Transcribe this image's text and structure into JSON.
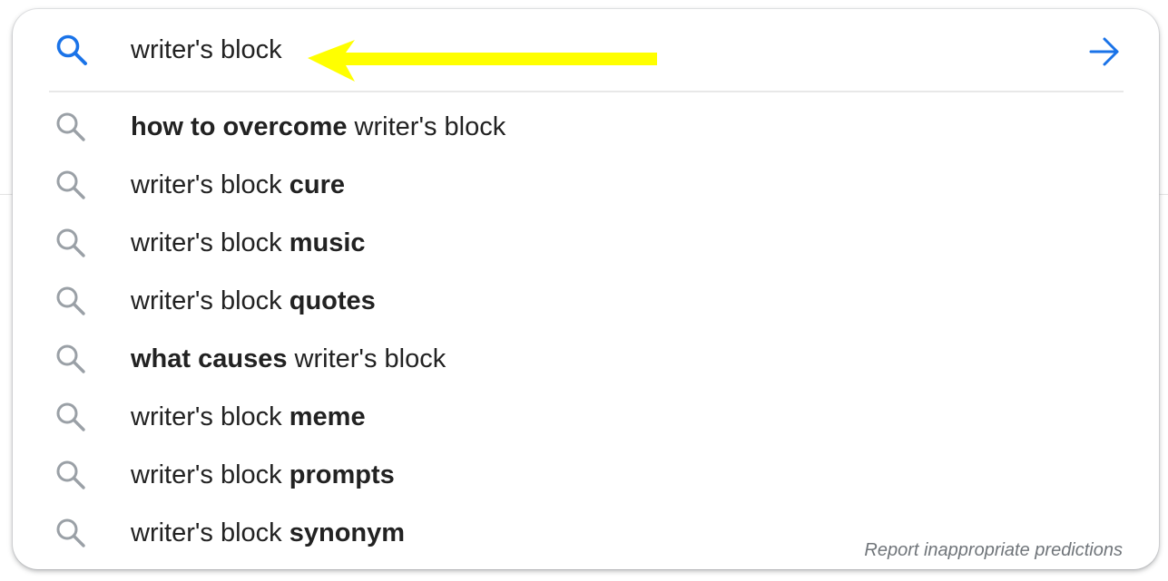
{
  "search": {
    "query": "writer's block",
    "accent_color": "#1a73e8"
  },
  "annotation": {
    "arrow_color": "#ffff00"
  },
  "suggestions": [
    {
      "pre": "",
      "bold_pre": "how to overcome",
      "mid": " writer's block",
      "bold_post": ""
    },
    {
      "pre": "",
      "bold_pre": "",
      "mid": "writer's block ",
      "bold_post": "cure"
    },
    {
      "pre": "",
      "bold_pre": "",
      "mid": "writer's block ",
      "bold_post": "music"
    },
    {
      "pre": "",
      "bold_pre": "",
      "mid": "writer's block ",
      "bold_post": "quotes"
    },
    {
      "pre": "",
      "bold_pre": "what causes",
      "mid": " writer's block",
      "bold_post": ""
    },
    {
      "pre": "",
      "bold_pre": "",
      "mid": "writer's block ",
      "bold_post": "meme"
    },
    {
      "pre": "",
      "bold_pre": "",
      "mid": "writer's block ",
      "bold_post": "prompts"
    },
    {
      "pre": "",
      "bold_pre": "",
      "mid": "writer's block ",
      "bold_post": "synonym"
    }
  ],
  "icons": {
    "search": "search-icon",
    "submit": "arrow-right-icon",
    "suggestion": "search-icon"
  },
  "footer": {
    "report_label": "Report inappropriate predictions"
  }
}
